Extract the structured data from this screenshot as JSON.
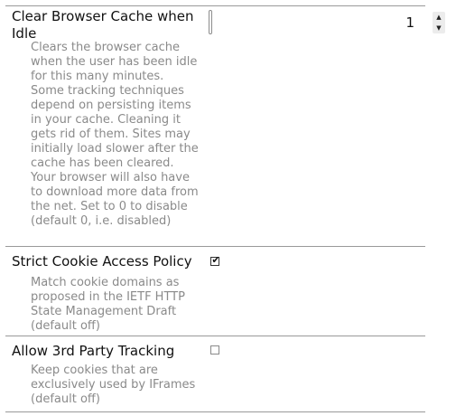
{
  "settings": [
    {
      "title": "Clear Browser Cache when Idle",
      "description": "Clears the browser cache when the user has been idle for this many minutes. Some tracking techniques depend on persisting items in your cache. Cleaning it gets rid of them. Sites may initially load slower after the cache has been cleared. Your browser will also have to download more data from the net. Set to 0 to disable (default 0, i.e. disabled)",
      "control": "number",
      "value": "1",
      "spin_up": "▲",
      "spin_down": "▼"
    },
    {
      "title": "Strict Cookie Access Policy",
      "description": "Match cookie domains as proposed in the IETF HTTP State Management Draft (default off)",
      "control": "checkbox",
      "checked": true,
      "check_glyph": "✔"
    },
    {
      "title": "Allow 3rd Party Tracking",
      "description": "Keep cookies that are exclusively used by IFrames (default off)",
      "control": "checkbox",
      "checked": false,
      "check_glyph": ""
    }
  ]
}
